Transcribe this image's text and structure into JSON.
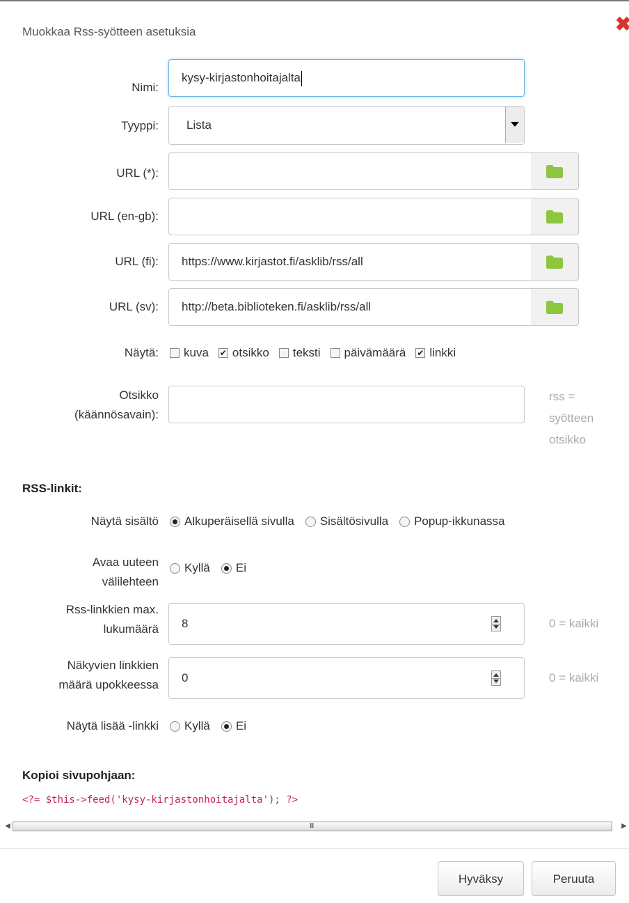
{
  "dialog": {
    "title": "Muokkaa Rss-syötteen asetuksia",
    "close_icon": "close-icon"
  },
  "form": {
    "name": {
      "label": "Nimi:",
      "value": "kysy-kirjastonhoitajalta"
    },
    "type": {
      "label": "Tyyppi:",
      "value": "Lista"
    },
    "urls": [
      {
        "label": "URL (*):",
        "value": ""
      },
      {
        "label": "URL (en-gb):",
        "value": ""
      },
      {
        "label": "URL (fi):",
        "value": "https://www.kirjastot.fi/asklib/rss/all"
      },
      {
        "label": "URL (sv):",
        "value": "http://beta.biblioteken.fi/asklib/rss/all"
      }
    ],
    "show": {
      "label": "Näytä:",
      "options": [
        {
          "label": "kuva",
          "checked": false
        },
        {
          "label": "otsikko",
          "checked": true
        },
        {
          "label": "teksti",
          "checked": false
        },
        {
          "label": "päivämäärä",
          "checked": false
        },
        {
          "label": "linkki",
          "checked": true
        }
      ]
    },
    "title_key": {
      "label_line1": "Otsikko",
      "label_line2": "(käännösavain):",
      "value": "",
      "hint_line1": "rss =",
      "hint_line2": "syötteen",
      "hint_line3": "otsikko"
    }
  },
  "rss_links": {
    "heading": "RSS-linkit:",
    "show_content": {
      "label": "Näytä sisältö",
      "options": [
        {
          "label": "Alkuperäisellä sivulla",
          "selected": true
        },
        {
          "label": "Sisältösivulla",
          "selected": false
        },
        {
          "label": "Popup-ikkunassa",
          "selected": false
        }
      ]
    },
    "new_tab": {
      "label_line1": "Avaa uuteen",
      "label_line2": "välilehteen",
      "options": [
        {
          "label": "Kyllä",
          "selected": false
        },
        {
          "label": "Ei",
          "selected": true
        }
      ]
    },
    "max_links": {
      "label_line1": "Rss-linkkien max.",
      "label_line2": "lukumäärä",
      "value": "8",
      "hint": "0 = kaikki"
    },
    "visible_links": {
      "label_line1": "Näkyvien linkkien",
      "label_line2": "määrä upokkeessa",
      "value": "0",
      "hint": "0 = kaikki"
    },
    "more_link": {
      "label": "Näytä lisää -linkki",
      "options": [
        {
          "label": "Kyllä",
          "selected": false
        },
        {
          "label": "Ei",
          "selected": true
        }
      ]
    }
  },
  "copy": {
    "heading": "Kopioi sivupohjaan:",
    "code": "<?= $this->feed('kysy-kirjastonhoitajalta'); ?>"
  },
  "scrollbar": {
    "grip": "III"
  },
  "buttons": {
    "accept": "Hyväksy",
    "cancel": "Peruuta"
  },
  "colors": {
    "folder_icon": "#8dc63f",
    "code_text": "#c7254e",
    "close_icon": "#d9322b",
    "focus_border": "#69b3e7"
  }
}
